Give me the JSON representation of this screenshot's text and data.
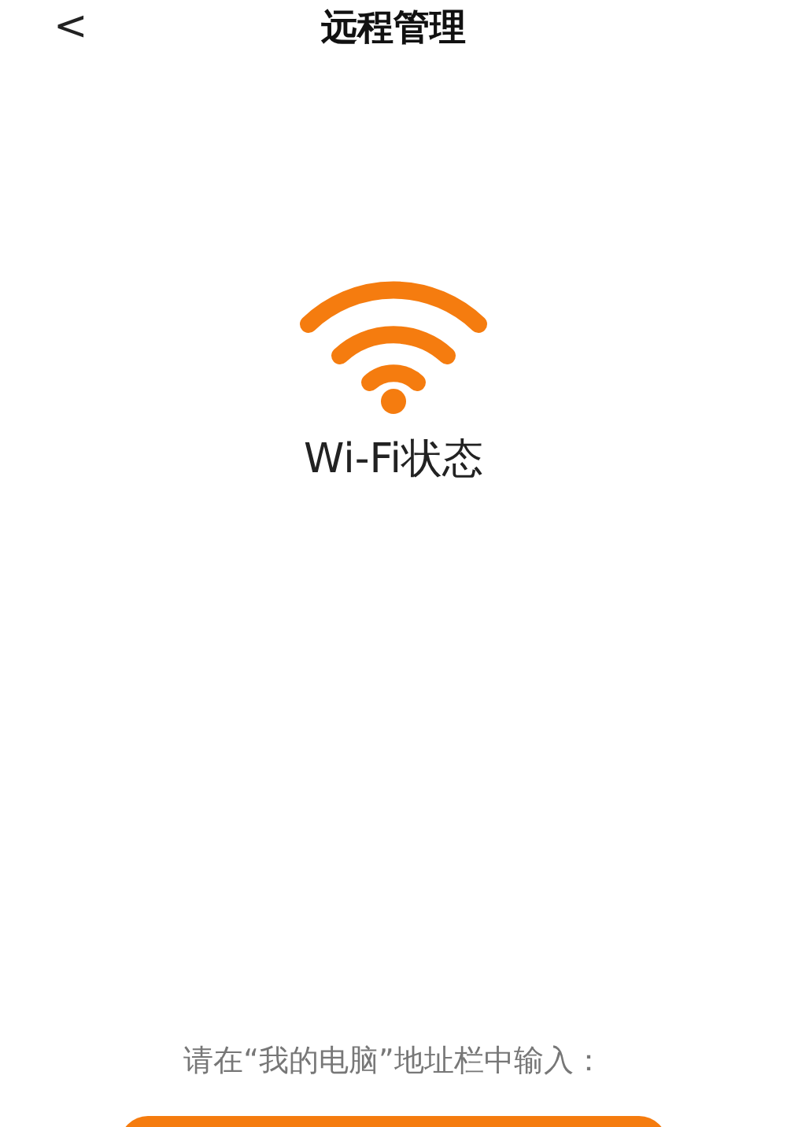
{
  "header": {
    "back": "<",
    "title": "远程管理"
  },
  "status": {
    "label": "Wi-Fi状态"
  },
  "instruction": "请在“我的电脑”地址栏中输入："
}
